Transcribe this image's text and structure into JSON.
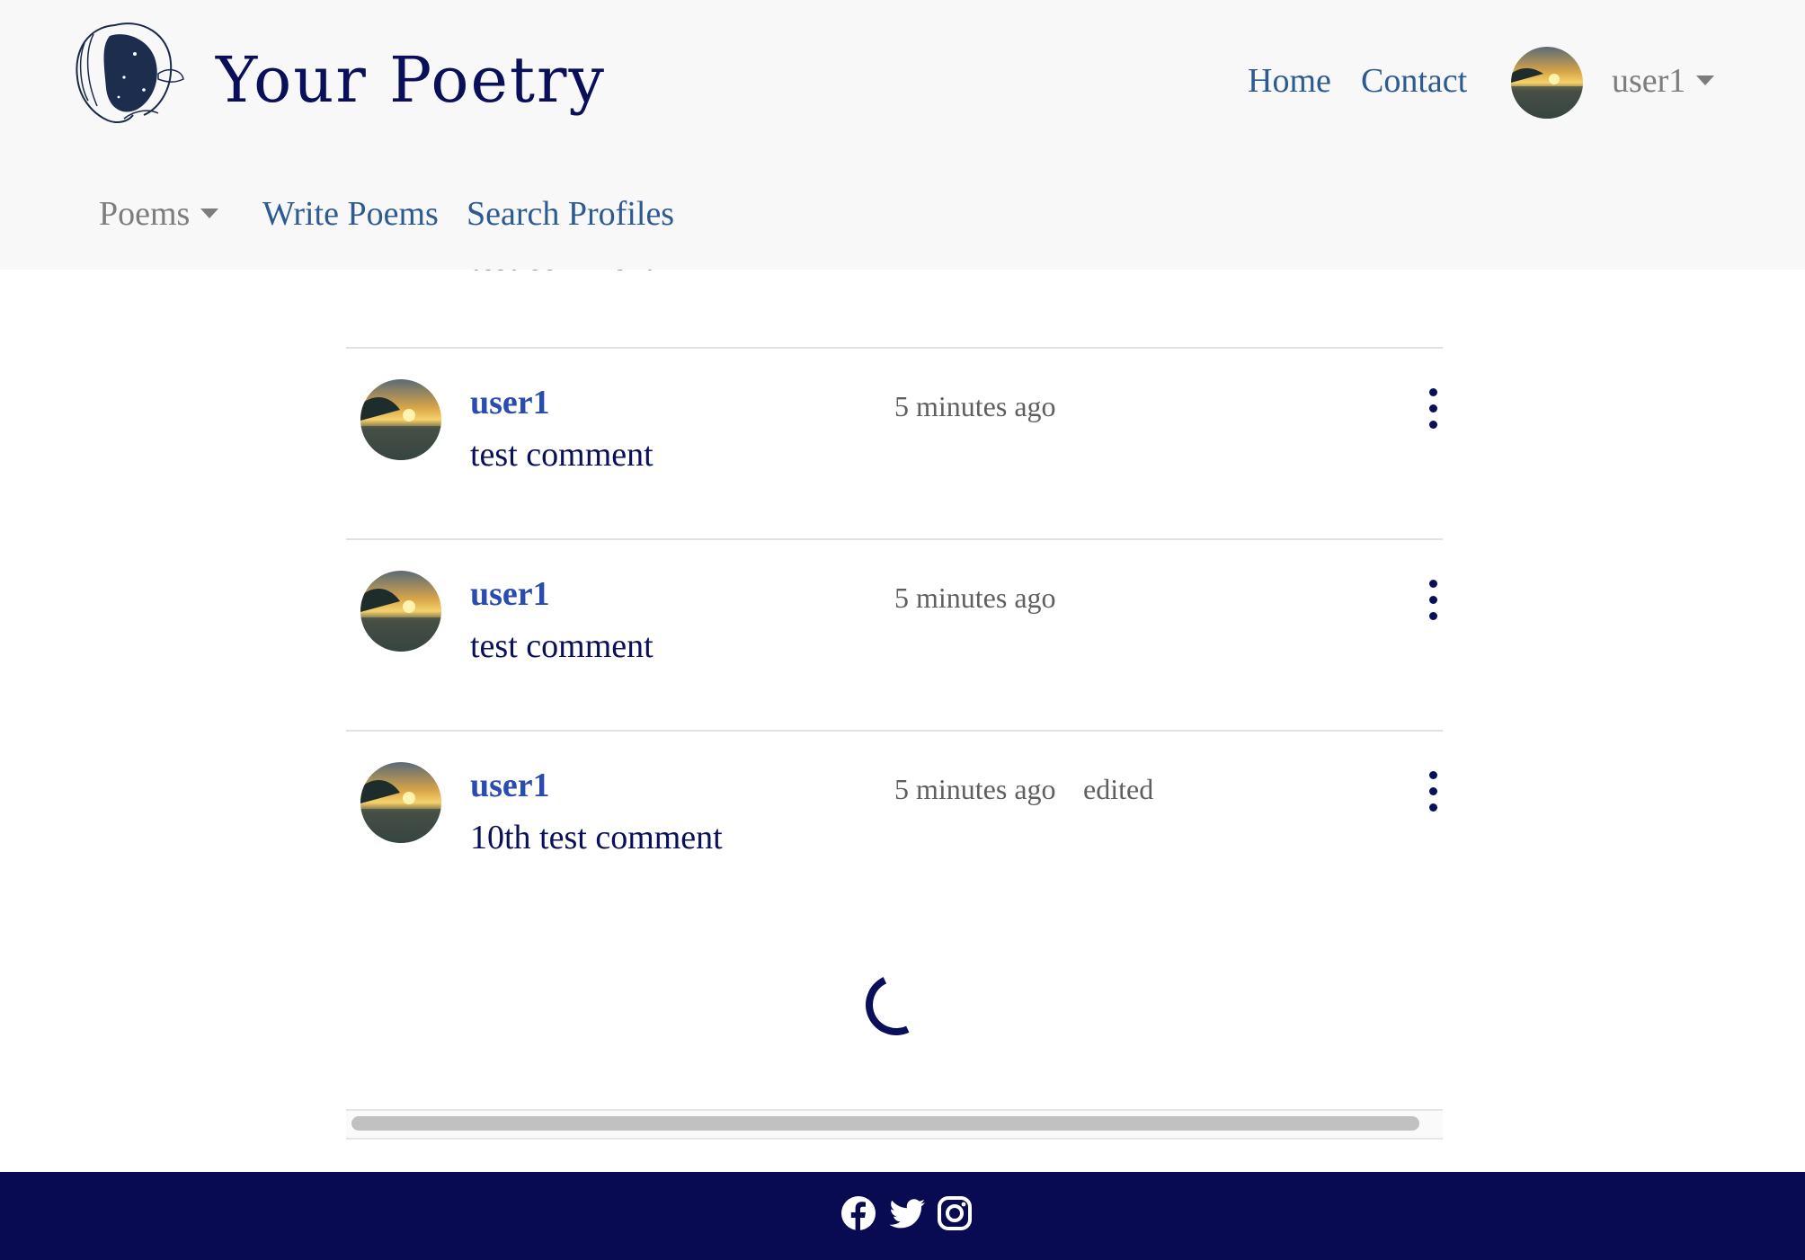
{
  "brand": {
    "name": "Your Poetry"
  },
  "nav": {
    "home": "Home",
    "contact": "Contact",
    "username": "user1",
    "poems": "Poems",
    "write_poems": "Write Poems",
    "search_profiles": "Search Profiles"
  },
  "comments": {
    "partial_text": "test comment",
    "items": [
      {
        "user": "user1",
        "time": "5 minutes ago",
        "edited": "",
        "text": "test comment"
      },
      {
        "user": "user1",
        "time": "5 minutes ago",
        "edited": "",
        "text": "test comment"
      },
      {
        "user": "user1",
        "time": "5 minutes ago",
        "edited": "edited",
        "text": "10th test comment"
      }
    ]
  },
  "footer": {
    "icons": [
      "facebook-icon",
      "twitter-icon",
      "instagram-icon"
    ]
  },
  "colors": {
    "primary_navy": "#0a0f5a",
    "link_blue": "#2d5a91",
    "username_blue": "#2a4cb0",
    "footer_bg": "#080b52",
    "navbar_bg": "#f8f8f8"
  }
}
